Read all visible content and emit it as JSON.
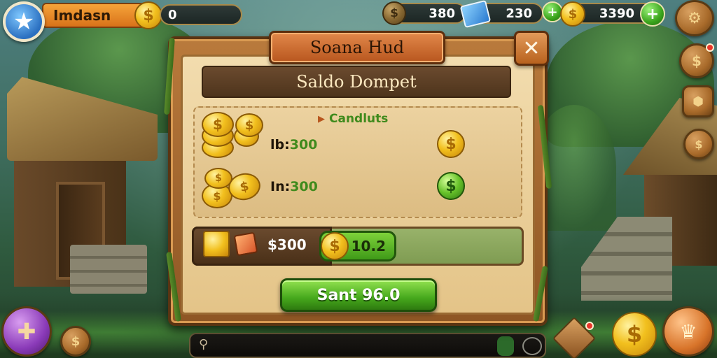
{
  "player": {
    "name": "Imdasn",
    "star_glyph": "★",
    "coins": "0"
  },
  "hud": {
    "resource1": "380",
    "resource2": "230",
    "resource3": "3390",
    "plus_glyph": "+"
  },
  "dialog": {
    "title": "Soana Hud",
    "subtitle": "Saldo Dompet",
    "close_glyph": "✕",
    "section_label": "Candluts",
    "rows": [
      {
        "label": "lb:",
        "value": "300"
      },
      {
        "label": "In:",
        "value": "300"
      }
    ],
    "total_price": "$300",
    "total_value": "10.2",
    "confirm_label": "Sant 96.0"
  },
  "icons": {
    "coin_glyph": "$",
    "row2_coin_glyph": "$"
  },
  "colors": {
    "accent_green": "#46a81c",
    "panel_wood": "#8e5624",
    "parchment": "#f2dcae",
    "banner_orange": "#b8561e"
  }
}
